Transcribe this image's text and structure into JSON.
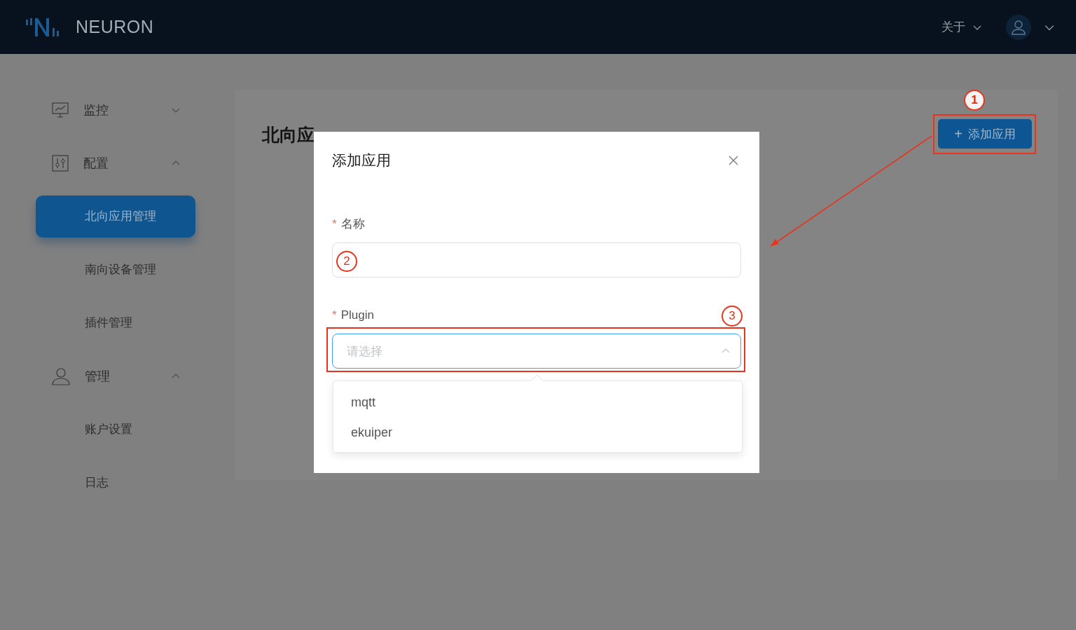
{
  "header": {
    "brand": "NEURON",
    "about_menu": {
      "label": "关于"
    }
  },
  "sidebar": [
    {
      "label": "监控",
      "expanded": false
    },
    {
      "label": "配置",
      "expanded": true,
      "children": [
        {
          "label": "北向应用管理",
          "selected": true
        },
        {
          "label": "南向设备管理",
          "selected": false
        },
        {
          "label": "插件管理",
          "selected": false
        }
      ]
    },
    {
      "label": "管理",
      "expanded": true,
      "children": [
        {
          "label": "账户设置",
          "selected": false
        },
        {
          "label": "日志",
          "selected": false
        }
      ]
    }
  ],
  "page": {
    "title": "北向应",
    "add_icon": "+",
    "add_button": "添加应用"
  },
  "dialog": {
    "title": "添加应用",
    "fields": [
      {
        "label": "名称",
        "required_mark": "*",
        "kind": "input"
      },
      {
        "label": "Plugin",
        "required_mark": "*",
        "kind": "select",
        "placeholder": "请选择",
        "expanded": true,
        "options": [
          "mqtt",
          "ekuiper"
        ]
      }
    ]
  },
  "annotations": [
    "1",
    "2",
    "3"
  ]
}
